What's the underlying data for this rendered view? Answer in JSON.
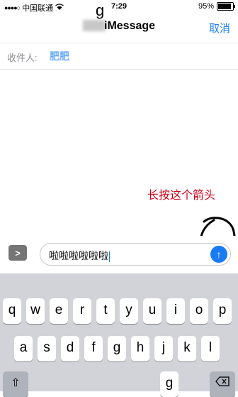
{
  "status_bar": {
    "signal": "●●●●○",
    "carrier": "中国联通",
    "wifi_icon": "wifi",
    "time": "7:29",
    "battery_percent": "95%"
  },
  "overlay": {
    "stray_letter": "g"
  },
  "nav": {
    "title": "iMessage",
    "cancel": "取消"
  },
  "recipient": {
    "label": "收件人:",
    "value": "肥肥"
  },
  "annotation": {
    "text": "长按这个箭头"
  },
  "composer": {
    "expand_icon": ">",
    "message_text": "啦啦啦啦啦啦",
    "send_icon": "↑"
  },
  "keyboard": {
    "row1": [
      "q",
      "w",
      "e",
      "r",
      "t",
      "y",
      "u",
      "i",
      "o",
      "p"
    ],
    "row2": [
      "a",
      "s",
      "d",
      "f",
      "g",
      "h",
      "j",
      "k",
      "l"
    ],
    "row3_visible": [
      "g"
    ],
    "shift": "⇧"
  }
}
